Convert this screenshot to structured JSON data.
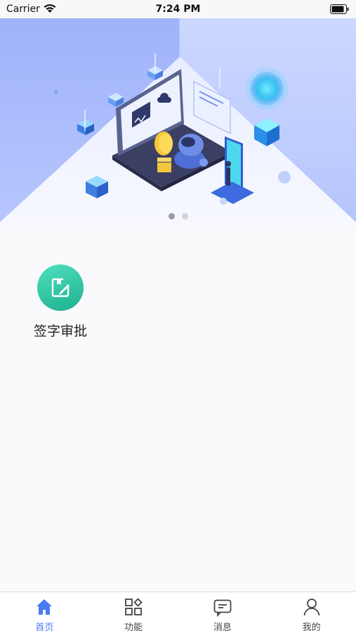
{
  "status_bar": {
    "carrier": "Carrier",
    "time": "7:24 PM"
  },
  "banner": {
    "page_count": 2,
    "active_page": 1
  },
  "home": {
    "items": [
      {
        "label": "签字审批",
        "icon": "sign-edit-icon",
        "color": "#2fc7a1"
      }
    ]
  },
  "tabbar": {
    "items": [
      {
        "label": "首页",
        "icon": "home-icon",
        "active": true
      },
      {
        "label": "功能",
        "icon": "grid-icon",
        "active": false
      },
      {
        "label": "消息",
        "icon": "message-icon",
        "active": false
      },
      {
        "label": "我的",
        "icon": "user-icon",
        "active": false
      }
    ],
    "active_color": "#4a7bf5",
    "inactive_color": "#444444"
  }
}
